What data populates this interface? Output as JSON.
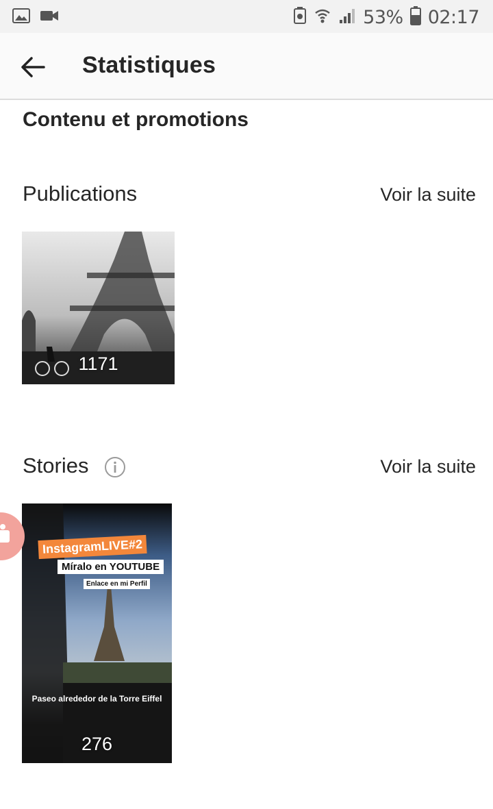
{
  "status_bar": {
    "battery": "53%",
    "time": "02:17"
  },
  "app_bar": {
    "title": "Statistiques"
  },
  "section": {
    "title": "Contenu et promotions"
  },
  "publications": {
    "title": "Publications",
    "see_more": "Voir la suite",
    "items": [
      {
        "count": "1171"
      }
    ]
  },
  "stories": {
    "title": "Stories",
    "see_more": "Voir la suite",
    "items": [
      {
        "count": "276",
        "overlay_tag": "InstagramLIVE#2",
        "overlay_sub": "Míralo en YOUTUBE",
        "overlay_link": "Enlace en mi Perfil",
        "caption": "Paseo alrededor de la Torre Eiffel"
      }
    ]
  },
  "colors": {
    "status_bar_bg": "#f2f2f2",
    "app_bar_bg": "#fafafa",
    "text": "#262626",
    "story_tag_bg": "#f3873b",
    "floating_button": "#f2a39c"
  }
}
